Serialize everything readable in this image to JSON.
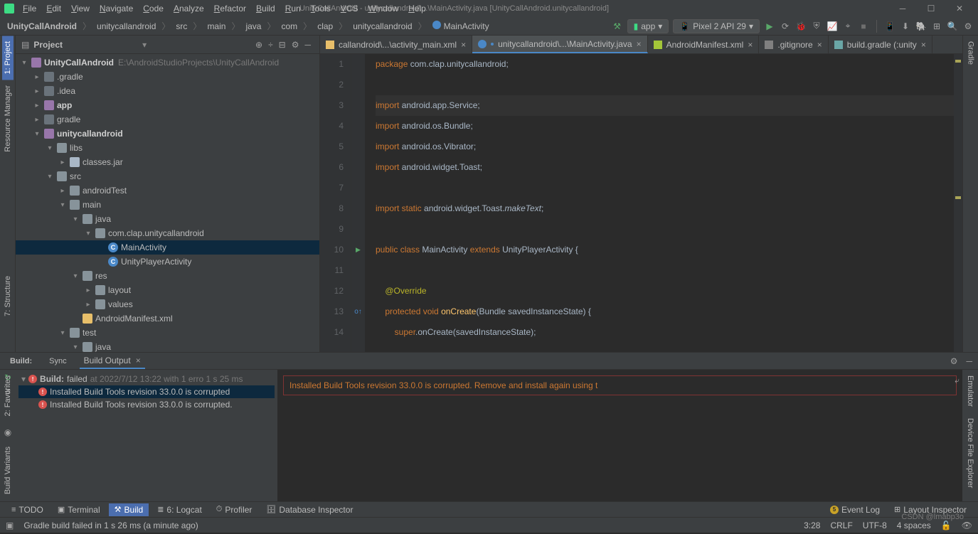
{
  "titlebar": {
    "title": "UnityCallAndroid - unitycallandroid\\...\\MainActivity.java [UnityCallAndroid.unitycallandroid]"
  },
  "menus": [
    "File",
    "Edit",
    "View",
    "Navigate",
    "Code",
    "Analyze",
    "Refactor",
    "Build",
    "Run",
    "Tools",
    "VCS",
    "Window",
    "Help"
  ],
  "breadcrumbs": [
    "UnityCallAndroid",
    "unitycallandroid",
    "src",
    "main",
    "java",
    "com",
    "clap",
    "unitycallandroid",
    "MainActivity"
  ],
  "run_config": {
    "app": "app",
    "device": "Pixel 2 API 29"
  },
  "sidebar": {
    "title": "Project",
    "root": {
      "name": "UnityCallAndroid",
      "path": "E:\\AndroidStudioProjects\\UnityCallAndroid"
    },
    "items": [
      {
        "depth": 1,
        "arrow": "right",
        "icon": "folder-dark",
        "label": ".gradle"
      },
      {
        "depth": 1,
        "arrow": "right",
        "icon": "folder-dark",
        "label": ".idea"
      },
      {
        "depth": 1,
        "arrow": "right",
        "icon": "module",
        "label": "app",
        "bold": true
      },
      {
        "depth": 1,
        "arrow": "right",
        "icon": "folder-dark",
        "label": "gradle"
      },
      {
        "depth": 1,
        "arrow": "down",
        "icon": "module",
        "label": "unitycallandroid",
        "bold": true
      },
      {
        "depth": 2,
        "arrow": "down",
        "icon": "folder",
        "label": "libs"
      },
      {
        "depth": 3,
        "arrow": "right",
        "icon": "jar",
        "label": "classes.jar"
      },
      {
        "depth": 2,
        "arrow": "down",
        "icon": "folder",
        "label": "src"
      },
      {
        "depth": 3,
        "arrow": "right",
        "icon": "folder",
        "label": "androidTest"
      },
      {
        "depth": 3,
        "arrow": "down",
        "icon": "folder",
        "label": "main"
      },
      {
        "depth": 4,
        "arrow": "down",
        "icon": "folder",
        "label": "java"
      },
      {
        "depth": 5,
        "arrow": "down",
        "icon": "folder",
        "label": "com.clap.unitycallandroid"
      },
      {
        "depth": 6,
        "arrow": "none",
        "icon": "class-c",
        "label": "MainActivity",
        "selected": true
      },
      {
        "depth": 6,
        "arrow": "none",
        "icon": "class-c",
        "label": "UnityPlayerActivity"
      },
      {
        "depth": 4,
        "arrow": "down",
        "icon": "folder",
        "label": "res"
      },
      {
        "depth": 5,
        "arrow": "right",
        "icon": "folder",
        "label": "layout"
      },
      {
        "depth": 5,
        "arrow": "right",
        "icon": "folder",
        "label": "values"
      },
      {
        "depth": 4,
        "arrow": "none",
        "icon": "xml",
        "label": "AndroidManifest.xml"
      },
      {
        "depth": 3,
        "arrow": "down",
        "icon": "folder",
        "label": "test"
      },
      {
        "depth": 4,
        "arrow": "down",
        "icon": "folder",
        "label": "java"
      }
    ]
  },
  "left_tabs": {
    "project": "1: Project",
    "resource_manager": "Resource Manager",
    "structure": "7: Structure",
    "favorites": "2: Favorites",
    "build_variants": "Build Variants"
  },
  "right_tabs": {
    "gradle": "Gradle",
    "emulator": "Emulator",
    "device_explorer": "Device File Explorer"
  },
  "editor_tabs": [
    {
      "icon": "xml",
      "label": "callandroid\\...\\activity_main.xml",
      "active": false
    },
    {
      "icon": "java",
      "label": "unitycallandroid\\...\\MainActivity.java",
      "active": true
    },
    {
      "icon": "manifest",
      "label": "AndroidManifest.xml",
      "active": false
    },
    {
      "icon": "git",
      "label": ".gitignore",
      "active": false
    },
    {
      "icon": "gradle",
      "label": "build.gradle (:unity",
      "active": false
    }
  ],
  "code": {
    "lines": [
      {
        "n": 1,
        "html": "<span class='kw'>package</span> <span class='ident'>com.clap.unitycallandroid</span><span class='ident'>;</span>"
      },
      {
        "n": 2,
        "html": ""
      },
      {
        "n": 3,
        "html": "<span class='kw'>import</span> <span class='ident'>android.app.Service</span><span class='ident'>;</span>",
        "hl": true
      },
      {
        "n": 4,
        "html": "<span class='kw'>import</span> <span class='ident'>android.os.Bundle</span><span class='ident'>;</span>"
      },
      {
        "n": 5,
        "html": "<span class='kw'>import</span> <span class='ident'>android.os.Vibrator</span><span class='ident'>;</span>"
      },
      {
        "n": 6,
        "html": "<span class='kw'>import</span> <span class='ident'>android.widget.Toast</span><span class='ident'>;</span>"
      },
      {
        "n": 7,
        "html": ""
      },
      {
        "n": 8,
        "html": "<span class='kw'>import static</span> <span class='ident'>android.widget.Toast.</span><span class='imp-static'>makeText</span><span class='ident'>;</span>"
      },
      {
        "n": 9,
        "html": ""
      },
      {
        "n": 10,
        "html": "<span class='kw'>public class</span> <span class='ident'>MainActivity </span><span class='kw'>extends</span> <span class='ident'>UnityPlayerActivity {</span>",
        "run": true
      },
      {
        "n": 11,
        "html": ""
      },
      {
        "n": 12,
        "html": "    <span class='ann'>@Override</span>"
      },
      {
        "n": 13,
        "html": "    <span class='kw'>protected void</span> <span class='method'>onCreate</span><span class='ident'>(Bundle savedInstanceState) {</span>",
        "override": true
      },
      {
        "n": 14,
        "html": "        <span class='kw'>super</span><span class='ident'>.onCreate(savedInstanceState);</span>"
      }
    ]
  },
  "build": {
    "header_build": "Build:",
    "header_sync": "Sync",
    "header_output": "Build Output",
    "root": {
      "label": "Build:",
      "status": "failed",
      "time": "at 2022/7/12 13:22 with 1 erro 1 s 25 ms"
    },
    "errors": [
      "Installed Build Tools revision 33.0.0 is corrupted",
      "Installed Build Tools revision 33.0.0 is corrupted."
    ],
    "output": "Installed Build Tools revision 33.0.0 is corrupted. Remove and install again using t"
  },
  "tooltabs": {
    "todo": "TODO",
    "terminal": "Terminal",
    "build": "Build",
    "logcat": "6: Logcat",
    "profiler": "Profiler",
    "db": "Database Inspector",
    "event_log": "Event Log",
    "event_count": "5",
    "layout_inspector": "Layout Inspector"
  },
  "statusbar": {
    "msg": "Gradle build failed in 1 s 26 ms (a minute ago)",
    "pos": "3:28",
    "eol": "CRLF",
    "enc": "UTF-8",
    "indent": "4 spaces"
  },
  "watermark": "CSDN @lmabp3o"
}
